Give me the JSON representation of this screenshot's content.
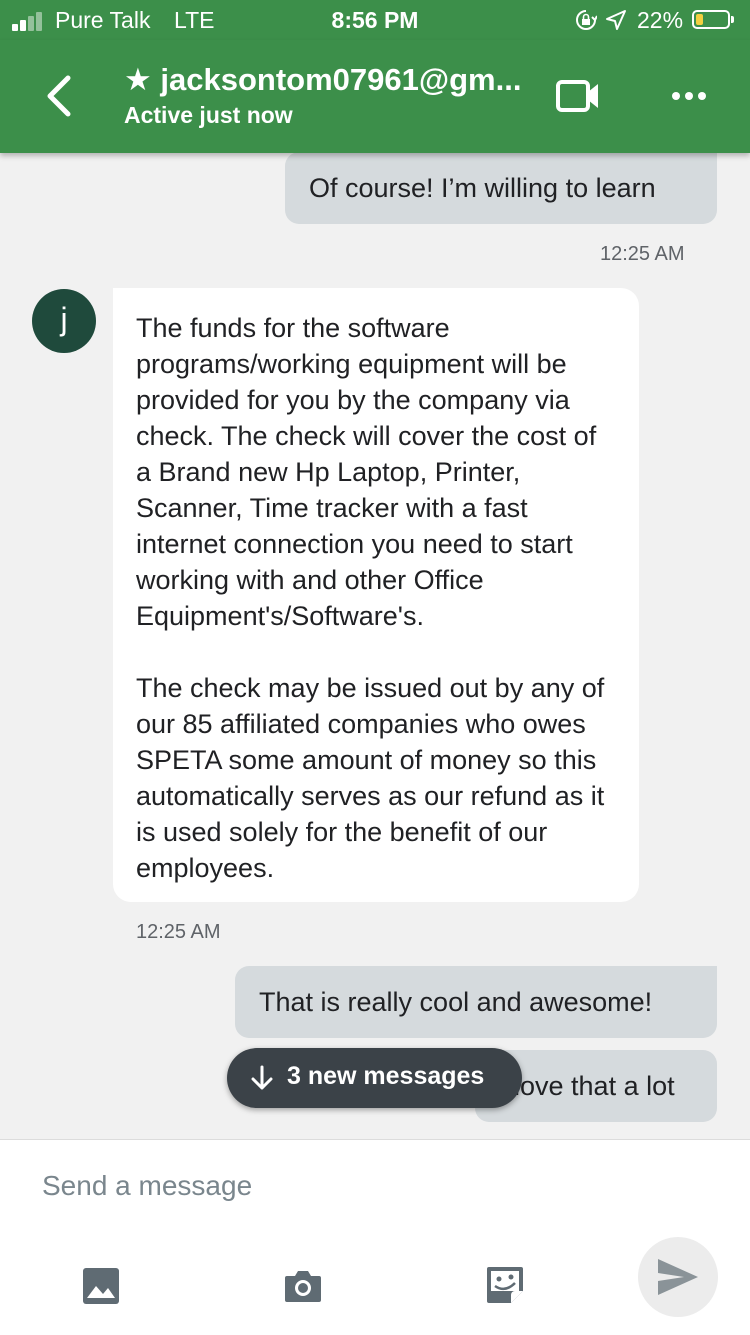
{
  "status_bar": {
    "carrier": "Pure Talk",
    "network": "LTE",
    "time": "8:56 PM",
    "battery_percent": "22%",
    "battery_level": 0.22,
    "signal_bars": 2,
    "icons": [
      "signal-icon",
      "orientation-lock-icon",
      "location-arrow-icon",
      "battery-icon"
    ]
  },
  "header": {
    "title": "★ jacksontom07961@gm...",
    "subtitle": "Active just now",
    "icons": [
      "back-arrow-icon",
      "video-call-icon",
      "more-options-icon"
    ]
  },
  "conversation": {
    "messages": [
      {
        "direction": "outgoing",
        "text": "Of course! I’m willing to learn",
        "time": "12:25 AM"
      },
      {
        "direction": "incoming",
        "sender_initial": "j",
        "paragraphs": [
          "The funds for the software programs/working equipment will be provided for you by the company via check. The check will cover the cost of a  Brand new Hp Laptop, Printer, Scanner, Time tracker with a fast internet connection you need to start working with and other Office Equipment's/Software's.",
          "The check may be issued out by any of our 85 affiliated companies who owes SPETA some amount of money so this automatically serves as our refund as it is used solely for the benefit of our employees."
        ],
        "time": "12:25 AM"
      },
      {
        "direction": "outgoing",
        "text": "That is really cool and awesome!"
      },
      {
        "direction": "outgoing",
        "text": "I love that a lot"
      }
    ],
    "new_messages_label": "3 new messages"
  },
  "composer": {
    "placeholder": "Send a message",
    "icons": [
      "gallery-icon",
      "camera-icon",
      "sticker-icon",
      "send-icon"
    ]
  },
  "colors": {
    "header_green": "#3c8f4a",
    "outgoing_bubble": "#d5dadd",
    "incoming_bubble": "#ffffff",
    "avatar": "#1f4a3c",
    "pill": "#3b4248",
    "icon_gray": "#5f6b73"
  }
}
